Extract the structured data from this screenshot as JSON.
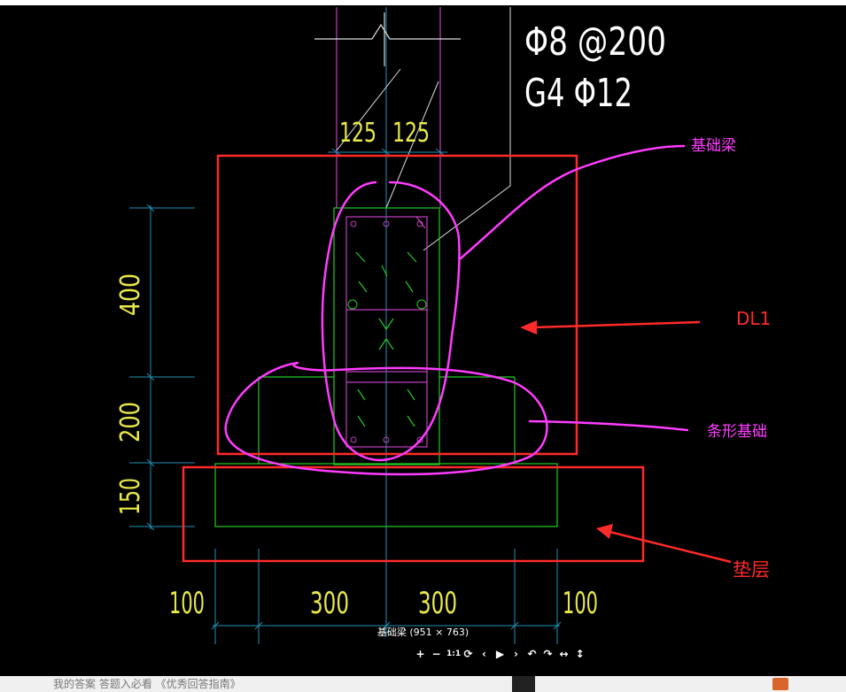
{
  "drawing": {
    "rebar_spec_line1": "Φ8 @200",
    "rebar_spec_line2": "G4 Φ12",
    "dim_top_left": "125",
    "dim_top_right": "125",
    "dim_left_upper": "400",
    "dim_left_middle": "200",
    "dim_left_lower": "150",
    "dim_bottom": [
      "100",
      "300",
      "300",
      "100"
    ]
  },
  "annotations": {
    "foundation_beam": "基础梁",
    "dl1": "DL1",
    "strip_foundation": "条形基础",
    "cushion_layer": "垫层"
  },
  "viewer": {
    "caption": "基础梁 (951 × 763)",
    "toolbar": [
      "+",
      "−",
      "1:1",
      "⟳",
      "‹",
      "▶",
      "›",
      "↶",
      "↷",
      "↔",
      "↕"
    ]
  },
  "page_footer": {
    "links": "我的答案   答题入必看 《优秀回答指南》"
  },
  "colors": {
    "background": "#000000",
    "outline_green": "#22cc22",
    "dimension_cyan": "#1e90b4",
    "dimension_text": "#e8e84a",
    "column_magenta": "#c040c0",
    "annotation_magenta": "#ff3cff",
    "annotation_red": "#ff2a2a"
  }
}
